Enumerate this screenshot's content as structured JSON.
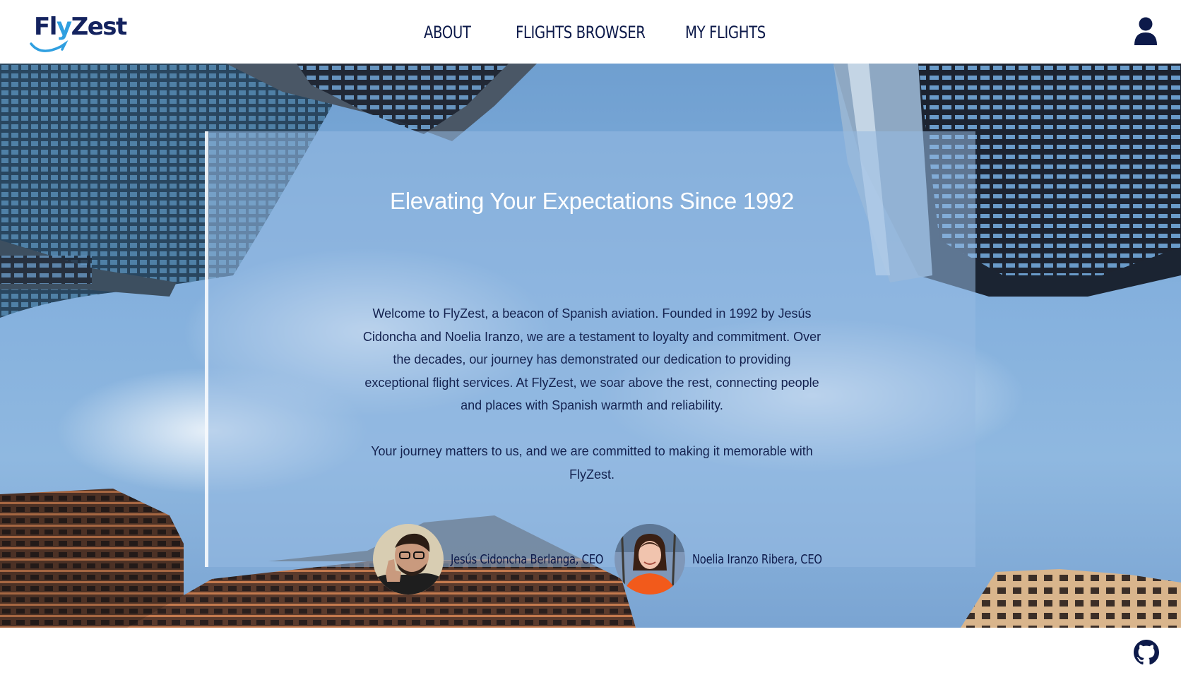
{
  "header": {
    "logo": {
      "part1": "Fly",
      "part2": "Zest"
    },
    "nav": [
      {
        "label": "ABOUT"
      },
      {
        "label": "FLIGHTS BROWSER"
      },
      {
        "label": "MY FLIGHTS"
      }
    ],
    "user_icon": "user-icon"
  },
  "about": {
    "title": "Elevating Your Expectations Since 1992",
    "paragraph_1": "Welcome to FlyZest, a beacon of Spanish aviation. Founded in 1992 by Jesús Cidoncha and Noelia Iranzo, we are a testament to loyalty and commitment. Over the decades, our journey has demonstrated our dedication to providing exceptional flight services. At FlyZest, we soar above the rest, connecting people and places with Spanish warmth and reliability.",
    "paragraph_2": "Your journey matters to us, and we are committed to making it memorable with FlyZest.",
    "founders": [
      {
        "name": "Jesús Cidoncha Berlanga, CEO"
      },
      {
        "name": "Noelia Iranzo Ribera, CEO"
      }
    ]
  },
  "footer": {
    "icon": "github-icon"
  },
  "colors": {
    "brand_navy": "#0d1a4a",
    "brand_blue": "#2f9fe0",
    "sky": "#84b0dd"
  }
}
